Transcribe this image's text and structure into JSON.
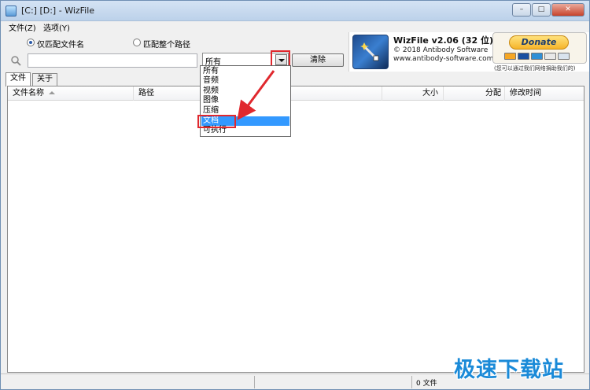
{
  "window": {
    "title": "[C:] [D:]  - WizFile",
    "buttons": {
      "minimize": "–",
      "maximize": "□",
      "close": "✕"
    }
  },
  "menu": [
    "文件(Z)",
    "选项(Y)"
  ],
  "search": {
    "radio_filename": "仅匹配文件名",
    "radio_fullpath": "匹配整个路径",
    "selected_radio": "filename",
    "input_value": "",
    "type_selected": "所有",
    "clear_label": "清除"
  },
  "about": {
    "product": "WizFile v2.06 (32 位)",
    "copyright": "© 2018 Antibody Software",
    "website": "www.antibody-software.com",
    "donate_label": "Donate",
    "donate_note": "(您可以通过我们网络捐助我们的)"
  },
  "tabs": [
    "文件",
    "关于"
  ],
  "columns": [
    "文件名称",
    "路径",
    "大小",
    "分配",
    "修改时间"
  ],
  "dropdown": {
    "items": [
      "所有",
      "音频",
      "视频",
      "图像",
      "压缩",
      "文档",
      "可执行"
    ],
    "selected_index": 5
  },
  "status": {
    "count": "0 文件"
  },
  "watermark": "极速下载站",
  "colors": {
    "accent": "#3399ff",
    "annotation": "#e0282e",
    "watermark": "#1a8ad8"
  }
}
